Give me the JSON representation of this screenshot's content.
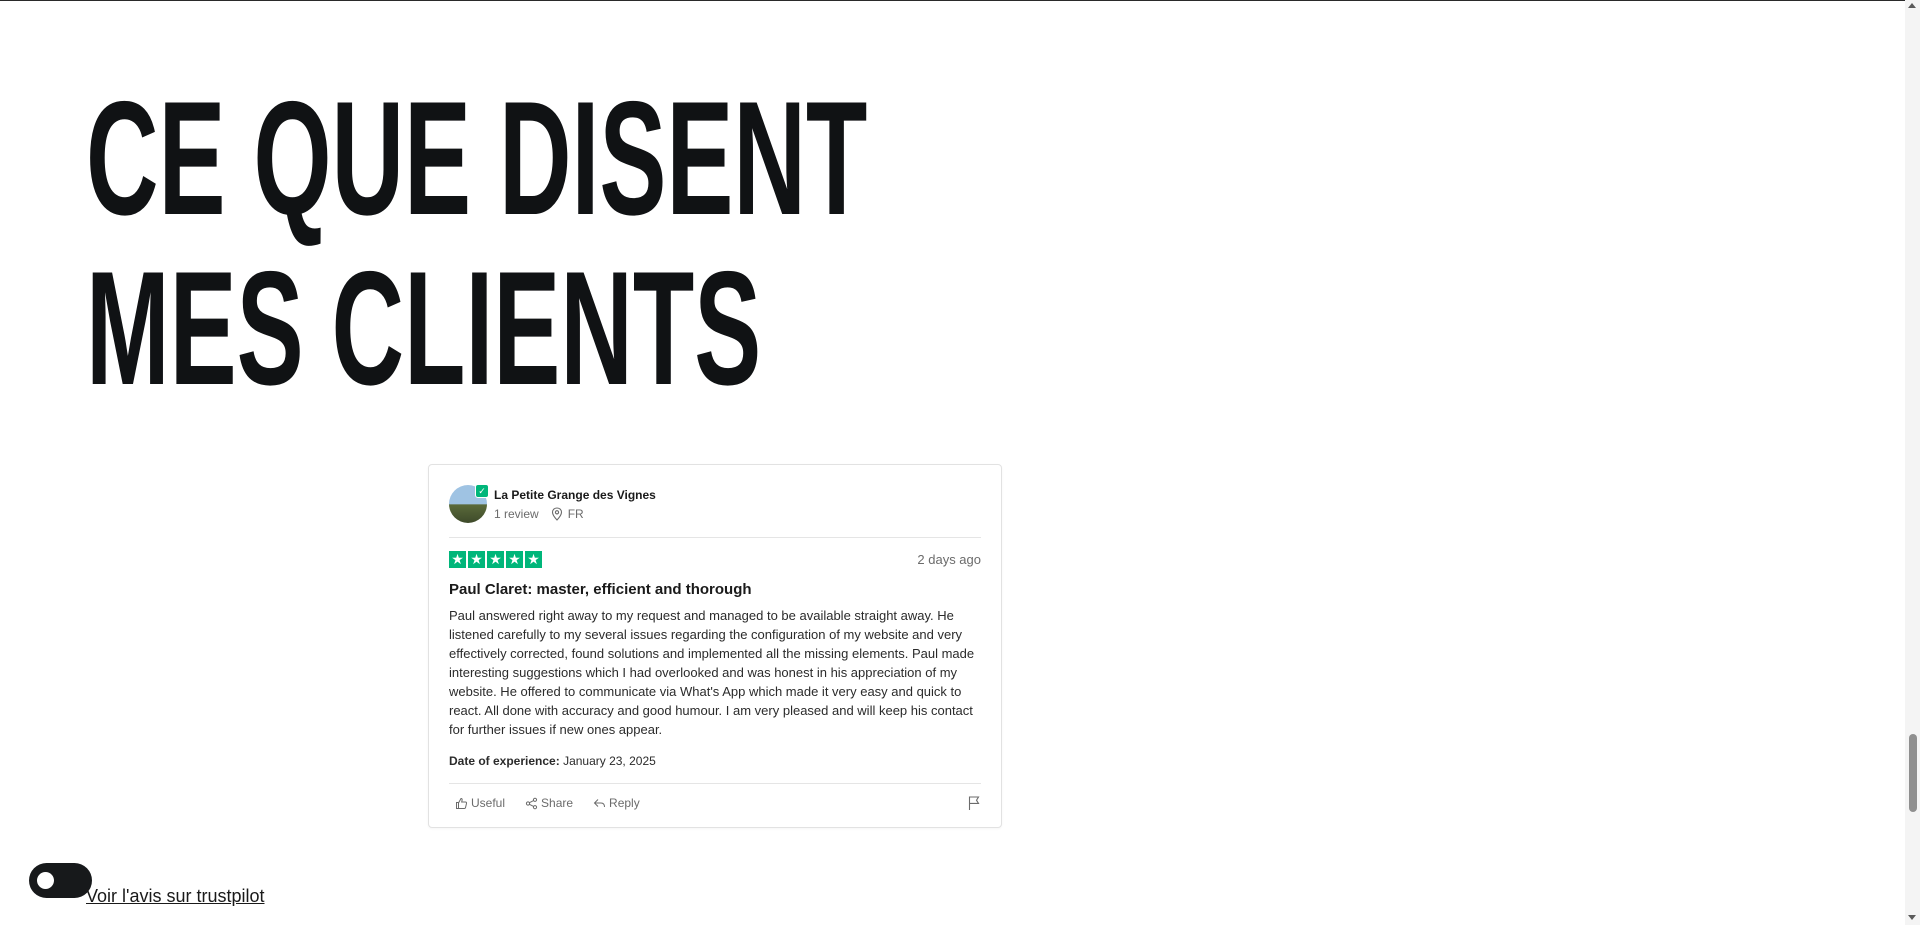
{
  "section": {
    "heading_line1": "CE QUE DISENT",
    "heading_line2": "MES CLIENTS"
  },
  "review": {
    "reviewer_name": "La Petite Grange des Vignes",
    "review_count": "1 review",
    "country": "FR",
    "rating": 5,
    "date_ago": "2 days ago",
    "title": "Paul Claret: master, efficient and thorough",
    "body": "Paul answered right away to my request and managed to be available straight away. He listened carefully to my several issues regarding the configuration of my website and very effectively corrected, found solutions and implemented all the missing elements. Paul made interesting suggestions which I had overlooked and was honest in his appreciation of my website. He offered to communicate via What's App which made it very easy and quick to react. All done with accuracy and good humour. I am very pleased and will keep his contact for further issues if new ones appear.",
    "experience_label": "Date of experience:",
    "experience_date": "January 23, 2025",
    "actions": {
      "useful": "Useful",
      "share": "Share",
      "reply": "Reply"
    },
    "star_color": "#00b67a"
  },
  "footer": {
    "trustpilot_link": "Voir l'avis sur trustpilot"
  },
  "icons": {
    "verified": "check-badge-icon",
    "location": "location-pin-icon",
    "thumbs_up": "thumbs-up-icon",
    "share": "share-icon",
    "reply": "reply-icon",
    "flag": "flag-icon",
    "toggle": "dark-mode-toggle"
  }
}
